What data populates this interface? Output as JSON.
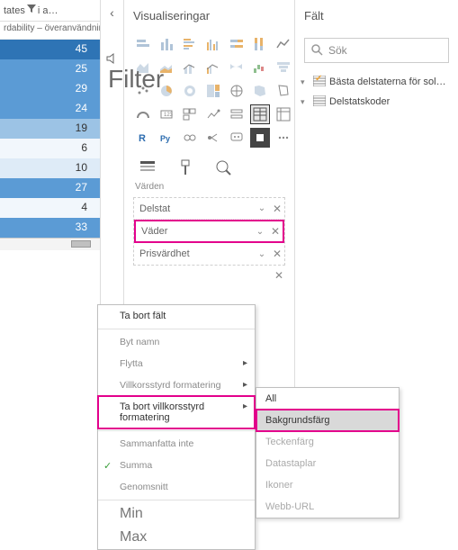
{
  "left": {
    "header_prefix": "tates",
    "header_suffix": "i a…",
    "subheader": "rdability – överanvändning",
    "values": [
      45,
      25,
      29,
      24,
      19,
      6,
      10,
      27,
      4,
      33
    ]
  },
  "viz": {
    "title": "Visualiseringar",
    "filter_overlay": "Filter",
    "varden_label": "Värden",
    "wells": [
      {
        "label": "Delstat"
      },
      {
        "label": "Väder",
        "highlight": true
      },
      {
        "label": "Prisvärdhet"
      }
    ]
  },
  "fields": {
    "title": "Fält",
    "search_placeholder": "Sök",
    "tables": [
      {
        "label": "Bästa delstaterna för sol…",
        "checked": true
      },
      {
        "label": "Delstatskoder",
        "checked": false
      }
    ]
  },
  "context_menu": {
    "items": [
      {
        "label": "Ta bort fält",
        "type": "header"
      },
      {
        "label": "Byt namn"
      },
      {
        "label": "Flytta",
        "submenu": true
      },
      {
        "label": "Villkorsstyrd formatering",
        "submenu": true
      },
      {
        "label": "Ta bort villkorsstyrd formatering",
        "submenu": true,
        "highlight": true
      },
      {
        "label": "Sammanfatta inte"
      },
      {
        "label": "Summa",
        "checked": true
      },
      {
        "label": "Genomsnitt"
      },
      {
        "label": "Min",
        "big": true
      },
      {
        "label": "Max",
        "big": true
      }
    ]
  },
  "sub_menu": {
    "items": [
      {
        "label": "All"
      },
      {
        "label": "Bakgrundsfärg",
        "selected": true,
        "highlight": true
      },
      {
        "label": "Teckenfärg",
        "disabled": true
      },
      {
        "label": "Datastaplar",
        "disabled": true
      },
      {
        "label": "Ikoner",
        "disabled": true
      },
      {
        "label": "Webb-URL",
        "disabled": true
      }
    ]
  },
  "chart_data": {
    "type": "table",
    "title": "rdability – överanvändning",
    "values": [
      45,
      25,
      29,
      24,
      19,
      6,
      10,
      27,
      4,
      33
    ]
  }
}
